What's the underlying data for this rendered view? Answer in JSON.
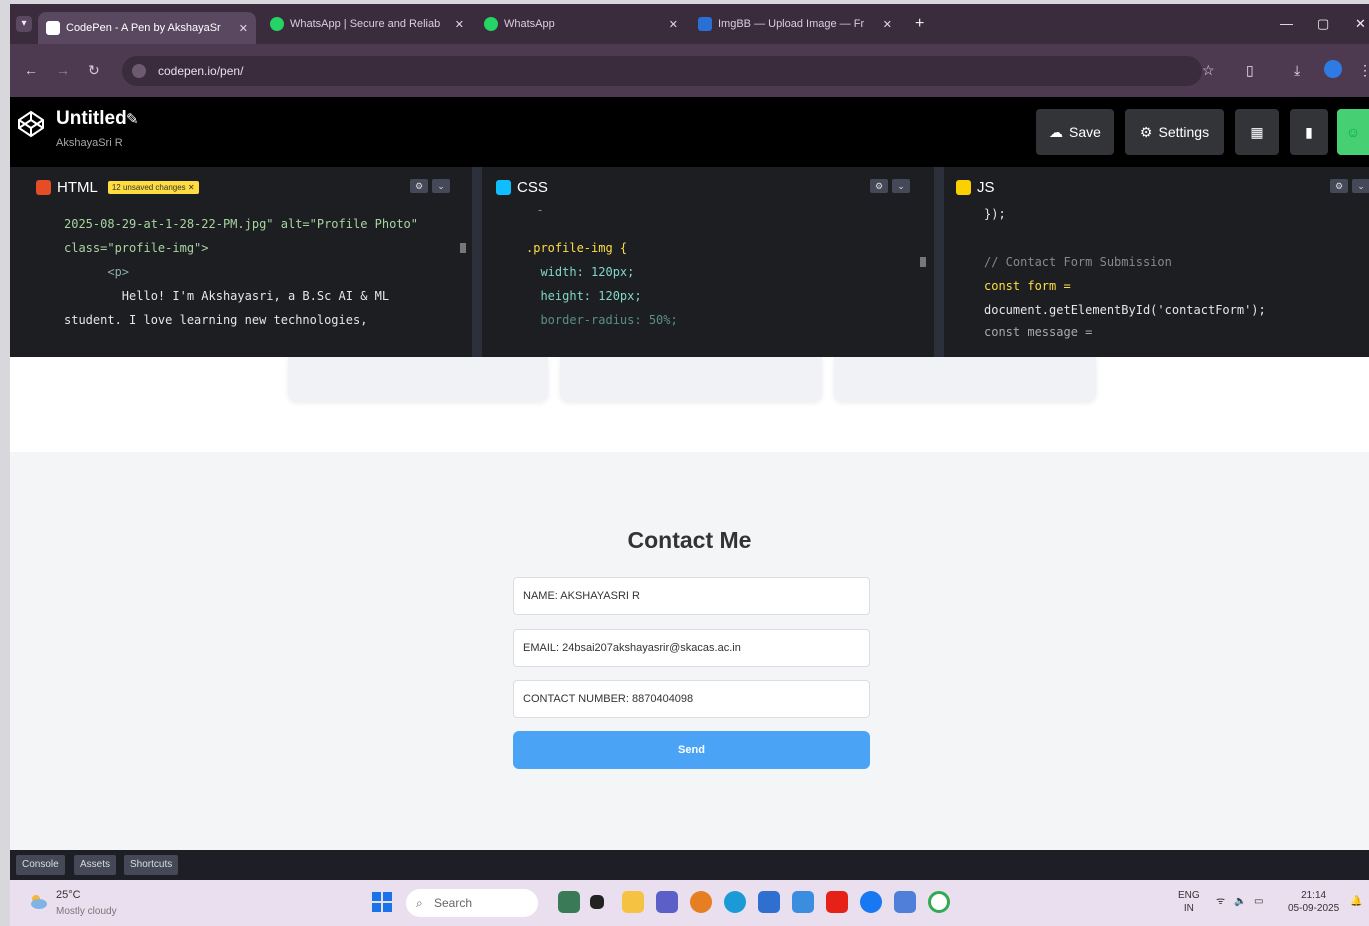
{
  "browser": {
    "tabs": [
      {
        "title": "CodePen - A Pen by AkshayaSr",
        "close": "✕",
        "active": true
      },
      {
        "title": "WhatsApp | Secure and Reliab",
        "close": "✕",
        "active": false
      },
      {
        "title": "WhatsApp",
        "close": "✕",
        "active": false
      },
      {
        "title": "ImgBB — Upload Image — Fr",
        "close": "✕",
        "active": false
      }
    ],
    "new_tab": "+",
    "window_controls": {
      "minimize": "—",
      "maximize": "▢",
      "close": "✕"
    },
    "address": "codepen.io/pen/",
    "icons": [
      "back-arrow-icon",
      "forward-arrow-icon",
      "reload-icon",
      "star-icon",
      "extensions-icon",
      "download-icon",
      "profile-icon",
      "menu-icon"
    ]
  },
  "codepen": {
    "title": "Untitled",
    "author": "AkshayaSri R",
    "save_label": "Save",
    "settings_label": "Settings"
  },
  "editors": {
    "html": {
      "label": "HTML",
      "badge": "12 unsaved changes ✕",
      "lines": [
        "2025-08-29-at-1-28-22-PM.jpg\" alt=\"Profile Photo\"",
        "class=\"profile-img\">",
        "      <p>",
        "        Hello! I'm Akshayasri, a B.Sc AI & ML",
        "student. I love learning new technologies,"
      ]
    },
    "css": {
      "label": "CSS",
      "lines": [
        "  -",
        "",
        ".profile-img {",
        "  width: 120px;",
        "  height: 120px;",
        "  border-radius: 50%;"
      ]
    },
    "js": {
      "label": "JS",
      "lines": [
        "});",
        "",
        "// Contact Form Submission",
        "const form =",
        "document.getElementById('contactForm');",
        "const message ="
      ]
    }
  },
  "contact": {
    "heading": "Contact Me",
    "name_value": "NAME: AKSHAYASRI R",
    "email_value": "EMAIL: 24bsai207akshayasrir@skacas.ac.in",
    "phone_value": "CONTACT NUMBER: 8870404098",
    "send_label": "Send"
  },
  "footer": {
    "console": "Console",
    "assets": "Assets",
    "shortcuts": "Shortcuts"
  },
  "taskbar": {
    "temperature": "25°C",
    "condition": "Mostly cloudy",
    "search_placeholder": "Search",
    "lang_line1": "ENG",
    "lang_line2": "IN",
    "time": "21:14",
    "date": "05-09-2025"
  },
  "colors": {
    "codepen_green": "#47cf73",
    "send_blue": "#4aa3f5",
    "html_red": "#e44d26",
    "css_blue": "#0ebeff",
    "js_yellow": "#fcd000"
  }
}
